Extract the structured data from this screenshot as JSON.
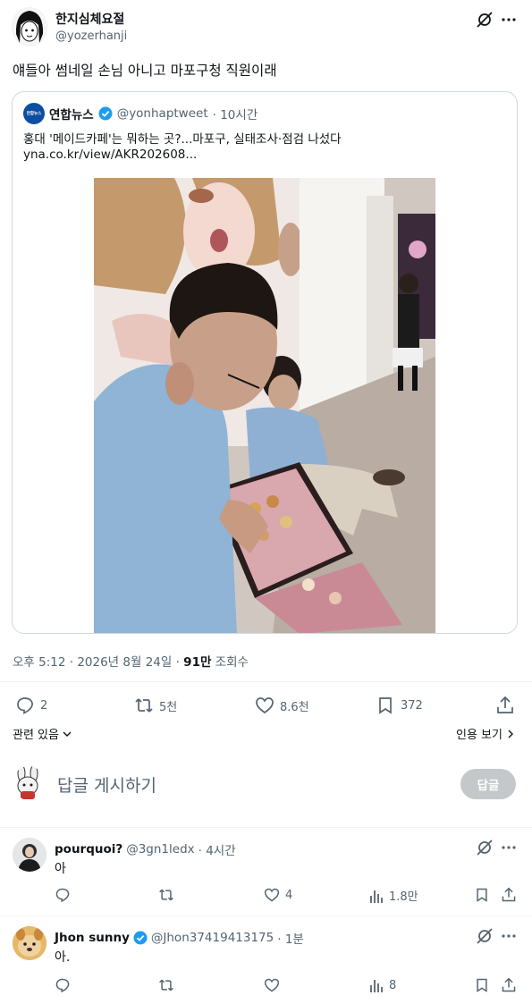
{
  "post": {
    "author_name": "한지심체요절",
    "author_handle": "@yozerhanji",
    "text": "얘들아 썸네일 손님 아니고 마포구청 직원이래",
    "meta_time": "오후 5:12 · 2026년 8월 24일 · ",
    "meta_views_count": "91만",
    "meta_views_label": " 조회수",
    "stats": {
      "replies": "2",
      "reposts": "5천",
      "likes": "8.6천",
      "bookmarks": "372"
    },
    "related_label": "관련 있음",
    "quotes_label": "인용 보기"
  },
  "quote": {
    "author_name": "연합뉴스",
    "author_handle": "@yonhaptweet",
    "time": "· 10시간",
    "avatar_text": "연합뉴스",
    "line1": "홍대 '메이드카페'는 뭐하는 곳?...마포구, 실태조사·점검 나섰다",
    "line2": "yna.co.kr/view/AKR202608..."
  },
  "reply_box": {
    "placeholder": "답글 게시하기",
    "button_label": "답글"
  },
  "replies": [
    {
      "name": "pourquoi?",
      "handle": "@3gn1ledx",
      "time": "· 4시간",
      "text": "아",
      "likes": "4",
      "views": "1.8만"
    },
    {
      "name": "Jhon sunny",
      "handle": "@Jhon37419413175",
      "time": "· 1분",
      "text": "아.",
      "likes": "",
      "views": "8"
    }
  ],
  "colors": {
    "text": "#0f1419",
    "muted": "#536471",
    "verified": "#1d9bf0",
    "border": "#cfd9de",
    "reply_button_bg": "#c4c8cb"
  },
  "icons": [
    "grok-icon",
    "more-icon",
    "verified-badge-icon",
    "reply-icon",
    "repost-icon",
    "like-icon",
    "bookmark-icon",
    "share-icon",
    "views-icon",
    "chevron-down-icon",
    "chevron-right-icon"
  ]
}
